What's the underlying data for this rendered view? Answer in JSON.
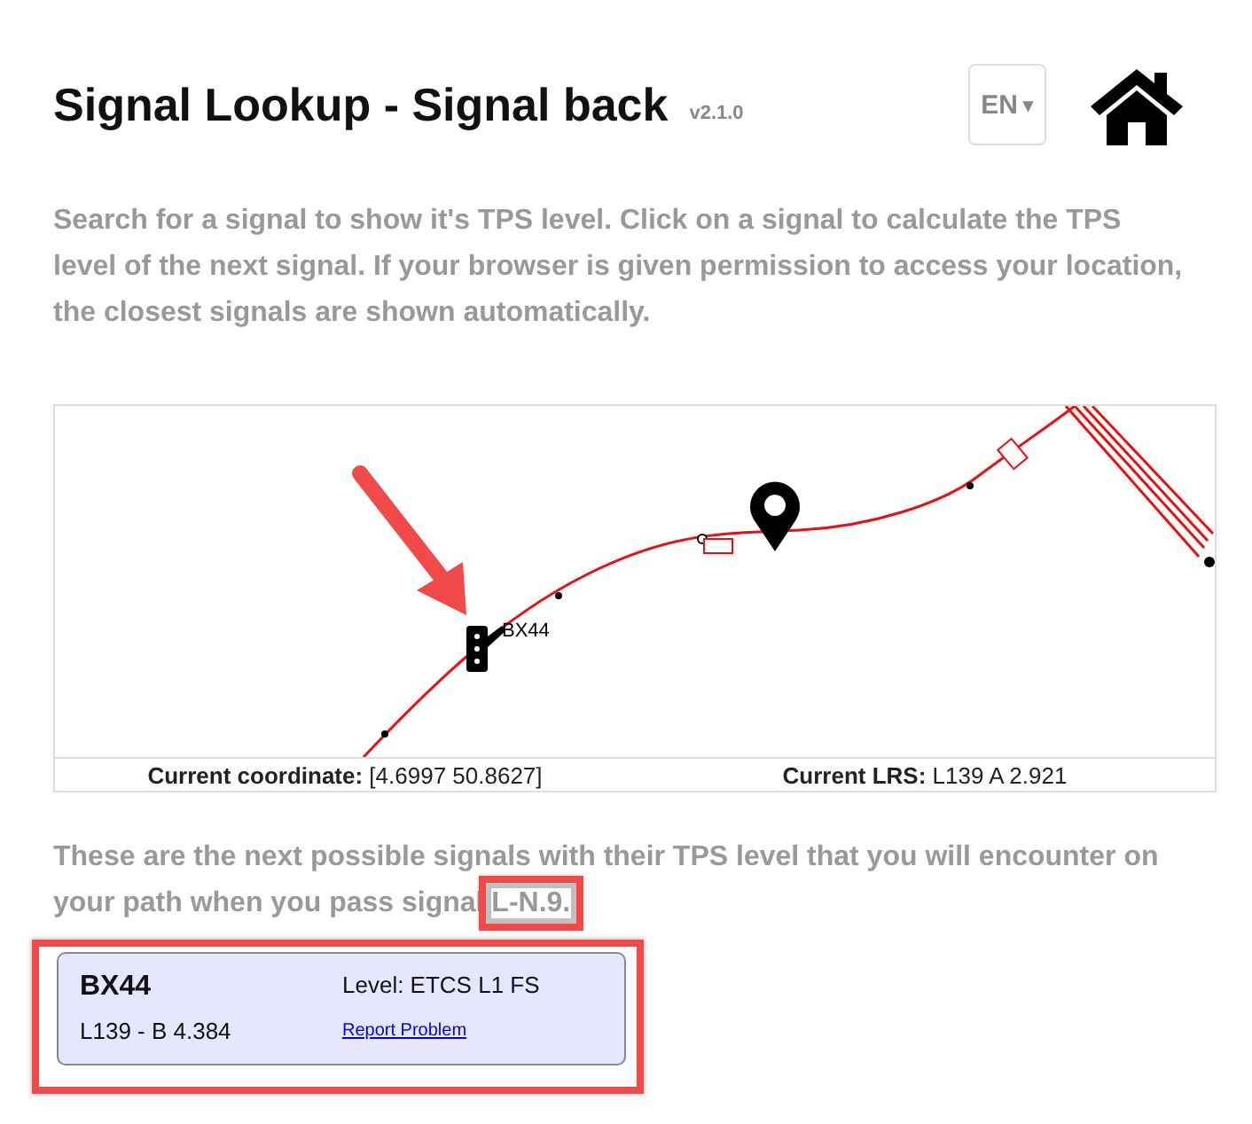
{
  "header": {
    "title": "Signal Lookup - Signal back",
    "version": "v2.1.0",
    "language": "EN",
    "language_caret": "▾"
  },
  "intro": "Search for a signal to show it's TPS level. Click on a signal to calculate the TPS level of the next signal. If your browser is given permission to access your location, the closest signals are shown automatically.",
  "map": {
    "signal_label": "BX44",
    "coordinate": "**Current coordinate:** [4.6997 50.8627]",
    "lrs": "**Current LRS:** L139 A 2.921"
  },
  "results_text": "These are the next possible signals with their TPS level that you will encounter on your path when you pass signal",
  "results_signal": "L-N.9.",
  "signals": [
    {
      "name": "BX44",
      "level": "Level: ETCS L1 FS",
      "location": "L139 - B 4.384",
      "report_link": "Report Problem"
    }
  ]
}
